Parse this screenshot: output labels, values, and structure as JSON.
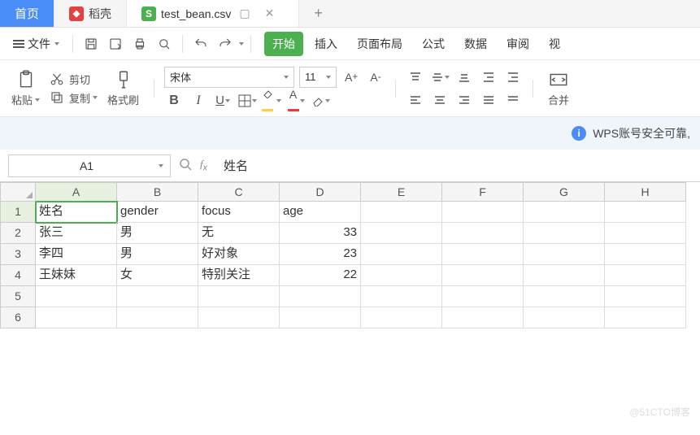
{
  "tabs": {
    "home": "首页",
    "doke": "稻壳",
    "file": "test_bean.csv"
  },
  "menubar": {
    "file": "文件"
  },
  "menutabs": {
    "start": "开始",
    "insert": "插入",
    "layout": "页面布局",
    "formula": "公式",
    "data": "数据",
    "review": "审阅",
    "view": "视"
  },
  "ribbon": {
    "paste": "粘贴",
    "cut": "剪切",
    "copy": "复制",
    "format": "格式刷",
    "merge": "合并",
    "fontname": "宋体",
    "fontsize": "11"
  },
  "notice": "WPS账号安全可靠,",
  "fx": {
    "ref": "A1",
    "val": "姓名"
  },
  "cols": [
    "A",
    "B",
    "C",
    "D",
    "E",
    "F",
    "G",
    "H"
  ],
  "rows": [
    "1",
    "2",
    "3",
    "4",
    "5",
    "6"
  ],
  "cells": {
    "r1": {
      "A": "姓名",
      "B": "gender",
      "C": "focus",
      "D": "age"
    },
    "r2": {
      "A": "张三",
      "B": "男",
      "C": "无",
      "D": "33"
    },
    "r3": {
      "A": "李四",
      "B": "男",
      "C": "好对象",
      "D": "23"
    },
    "r4": {
      "A": "王妹妹",
      "B": "女",
      "C": "特别关注",
      "D": "22"
    }
  },
  "watermark": "@51CTO博客"
}
